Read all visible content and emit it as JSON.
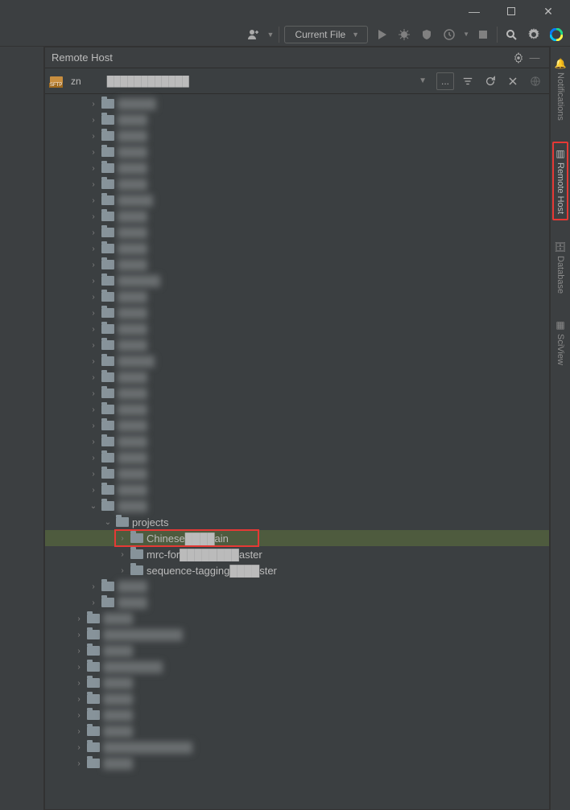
{
  "window": {
    "minimize": "—",
    "maximize": "□",
    "close": "✕"
  },
  "toolbar": {
    "current_file": "Current File"
  },
  "panel": {
    "title": "Remote Host"
  },
  "connection": {
    "host_label": "zn",
    "browse": "..."
  },
  "right_rail": {
    "notifications": "Notifications",
    "remote_host": "Remote Host",
    "database": "Database",
    "sciview": "SciView"
  },
  "tree": {
    "items": [
      {
        "depth": 3,
        "arrow": "collapsed",
        "label": "████er",
        "blur": true
      },
      {
        "depth": 3,
        "arrow": "collapsed",
        "label": "████",
        "blur": true
      },
      {
        "depth": 3,
        "arrow": "collapsed",
        "label": "████",
        "blur": true
      },
      {
        "depth": 3,
        "arrow": "collapsed",
        "label": "████",
        "blur": true
      },
      {
        "depth": 3,
        "arrow": "collapsed",
        "label": "████",
        "blur": true
      },
      {
        "depth": 3,
        "arrow": "collapsed",
        "label": "████",
        "blur": true
      },
      {
        "depth": 3,
        "arrow": "collapsed",
        "label": "████h",
        "blur": true
      },
      {
        "depth": 3,
        "arrow": "collapsed",
        "label": "████",
        "blur": true
      },
      {
        "depth": 3,
        "arrow": "collapsed",
        "label": "████",
        "blur": true
      },
      {
        "depth": 3,
        "arrow": "collapsed",
        "label": "████",
        "blur": true
      },
      {
        "depth": 3,
        "arrow": "collapsed",
        "label": "████",
        "blur": true
      },
      {
        "depth": 3,
        "arrow": "collapsed",
        "label": "█████o",
        "blur": true
      },
      {
        "depth": 3,
        "arrow": "collapsed",
        "label": "████",
        "blur": true
      },
      {
        "depth": 3,
        "arrow": "collapsed",
        "label": "████",
        "blur": true
      },
      {
        "depth": 3,
        "arrow": "collapsed",
        "label": "████",
        "blur": true
      },
      {
        "depth": 3,
        "arrow": "collapsed",
        "label": "████",
        "blur": true
      },
      {
        "depth": 3,
        "arrow": "collapsed",
        "label": "████w",
        "blur": true
      },
      {
        "depth": 3,
        "arrow": "collapsed",
        "label": "████",
        "blur": true
      },
      {
        "depth": 3,
        "arrow": "collapsed",
        "label": "████",
        "blur": true
      },
      {
        "depth": 3,
        "arrow": "collapsed",
        "label": "████",
        "blur": true
      },
      {
        "depth": 3,
        "arrow": "collapsed",
        "label": "████",
        "blur": true
      },
      {
        "depth": 3,
        "arrow": "collapsed",
        "label": "████",
        "blur": true
      },
      {
        "depth": 3,
        "arrow": "collapsed",
        "label": "████",
        "blur": true
      },
      {
        "depth": 3,
        "arrow": "collapsed",
        "label": "████",
        "blur": true
      },
      {
        "depth": 3,
        "arrow": "collapsed",
        "label": "████",
        "blur": true
      },
      {
        "depth": 3,
        "arrow": "expanded",
        "label": "████",
        "blur": true
      },
      {
        "depth": 4,
        "arrow": "expanded",
        "label": "projects",
        "blur": false
      },
      {
        "depth": 5,
        "arrow": "collapsed",
        "label": "Chinese████ain",
        "blur": false,
        "selected": true,
        "redbox": true
      },
      {
        "depth": 5,
        "arrow": "collapsed",
        "label": "mrc-for████████aster",
        "blur": false
      },
      {
        "depth": 5,
        "arrow": "collapsed",
        "label": "sequence-tagging████ster",
        "blur": false
      },
      {
        "depth": 3,
        "arrow": "collapsed",
        "label": "████",
        "blur": true
      },
      {
        "depth": 3,
        "arrow": "collapsed",
        "label": "████",
        "blur": true
      },
      {
        "depth": 2,
        "arrow": "collapsed",
        "label": "████",
        "blur": true
      },
      {
        "depth": 2,
        "arrow": "collapsed",
        "label": "██████████s",
        "blur": true
      },
      {
        "depth": 2,
        "arrow": "collapsed",
        "label": "████",
        "blur": true
      },
      {
        "depth": 2,
        "arrow": "collapsed",
        "label": "████████",
        "blur": true
      },
      {
        "depth": 2,
        "arrow": "collapsed",
        "label": "████",
        "blur": true
      },
      {
        "depth": 2,
        "arrow": "collapsed",
        "label": "████",
        "blur": true
      },
      {
        "depth": 2,
        "arrow": "collapsed",
        "label": "████",
        "blur": true
      },
      {
        "depth": 2,
        "arrow": "collapsed",
        "label": "████",
        "blur": true
      },
      {
        "depth": 2,
        "arrow": "collapsed",
        "label": "████████████",
        "blur": true
      },
      {
        "depth": 2,
        "arrow": "collapsed",
        "label": "████",
        "blur": true
      }
    ]
  }
}
